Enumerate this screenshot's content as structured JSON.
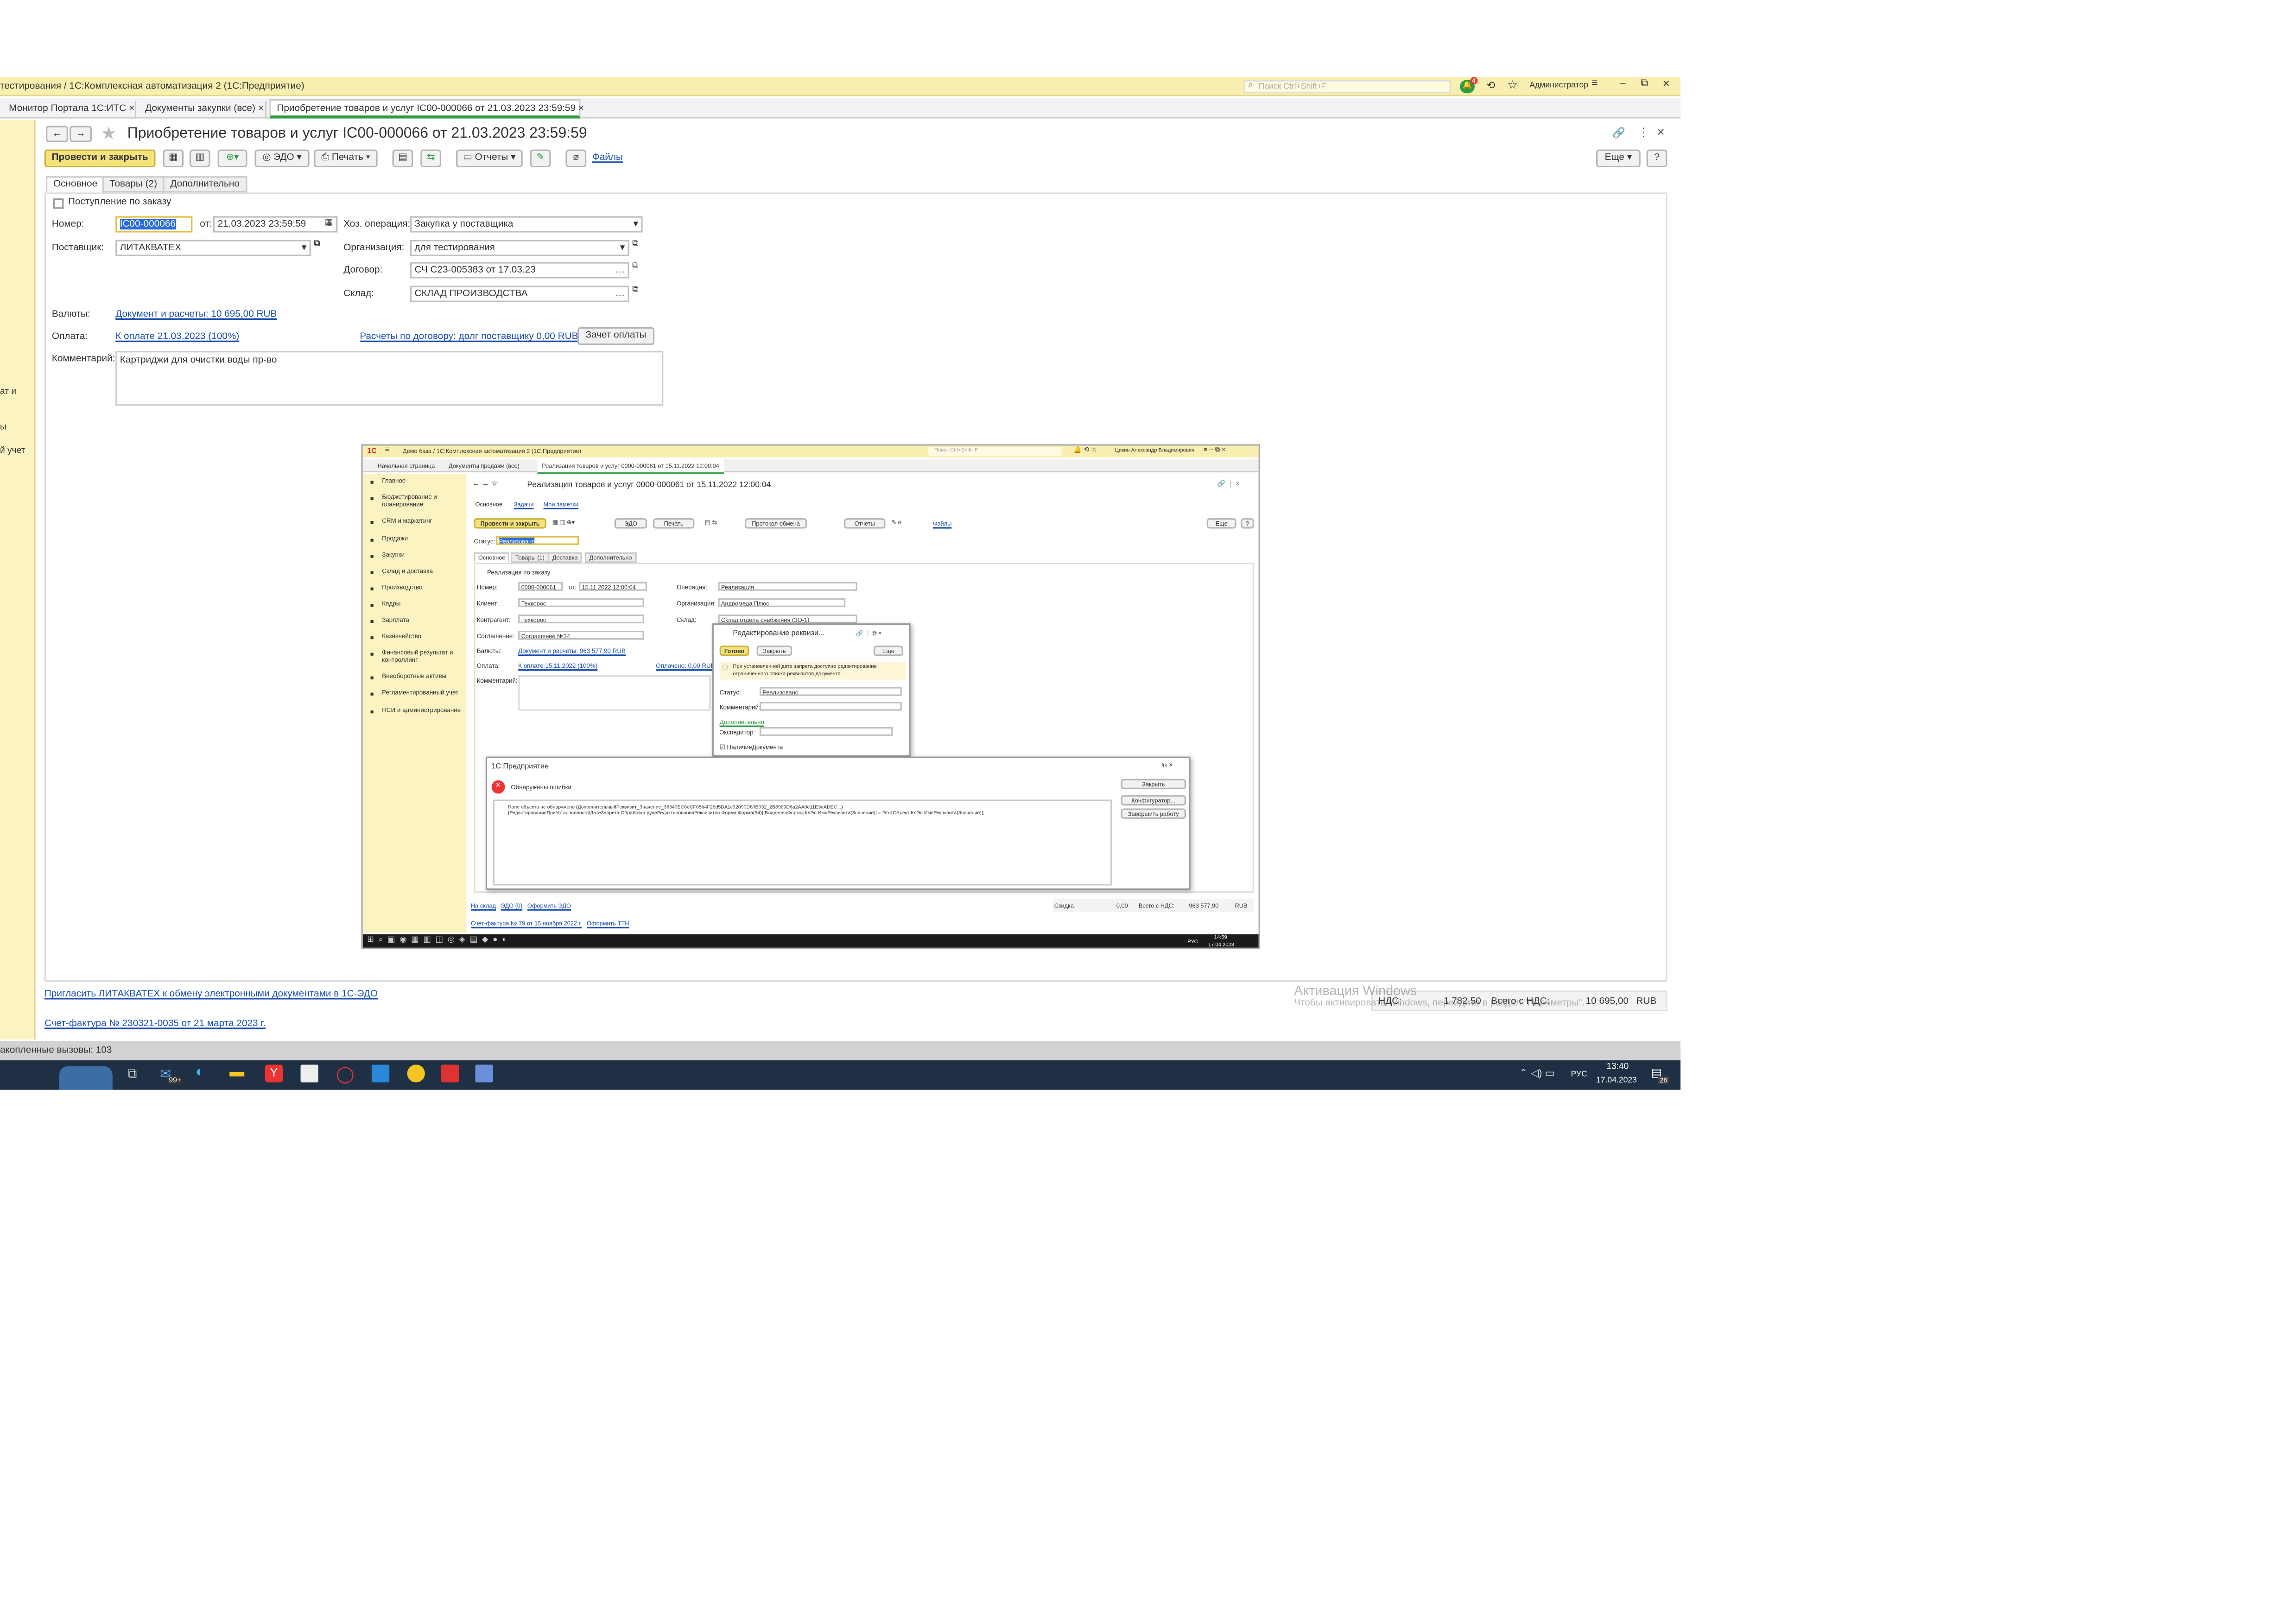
{
  "app": {
    "title": "тестирования / 1С:Комплексная автоматизация 2  (1С:Предприятие)",
    "search_placeholder": "Поиск Ctrl+Shift+F",
    "notif_count": "4",
    "user": "Администратор",
    "tabs": [
      "Монитор Портала 1С:ИТС",
      "Документы закупки (все)",
      "Приобретение товаров и услуг IC00-000066 от 21.03.2023 23:59:59"
    ]
  },
  "doc": {
    "title": "Приобретение товаров и услуг IC00-000066 от 21.03.2023 23:59:59",
    "toolbar": {
      "post_close": "Провести и закрыть",
      "edo": "ЭДО",
      "print": "Печать",
      "reports": "Отчеты",
      "files": "Файлы",
      "more": "Еще",
      "help": "?"
    },
    "tabs": [
      "Основное",
      "Товары (2)",
      "Дополнительно"
    ],
    "by_order": "Поступление по заказу",
    "number_label": "Номер:",
    "number": "IC00-000066",
    "from_label": "от:",
    "date": "21.03.2023 23:59:59",
    "operation_label": "Хоз. операция:",
    "operation": "Закупка у поставщика",
    "supplier_label": "Поставщик:",
    "supplier": "ЛИТАКВАТЕХ",
    "org_label": "Организация:",
    "org": "для тестирования",
    "contract_label": "Договор:",
    "contract": "СЧ С23-005383 от 17.03.23",
    "warehouse_label": "Склад:",
    "warehouse": "СКЛАД ПРОИЗВОДСТВА",
    "currency_label": "Валюты:",
    "currency_link": "Документ и расчеты: 10 695,00 RUB",
    "payment_label": "Оплата:",
    "payment_link": "К оплате 21.03.2023 (100%)",
    "debt_link": "Расчеты по договору: долг поставщику 0,00 RUB",
    "offset_btn": "Зачет оплаты",
    "comment_label": "Комментарий:",
    "comment": "Картриджи для очистки воды пр-во",
    "invite_link": "Пригласить ЛИТАКВАТЕХ к обмену электронными документами в 1С-ЭДО",
    "invoice_link": "Счет-фактура № 230321-0035 от 21 марта 2023 г.",
    "vat_label": "НДС:",
    "vat": "1 782,50",
    "total_label": "Всего с НДС:",
    "total": "10 695,00",
    "cur": "RUB"
  },
  "left_partial": [
    "ат и",
    "ы",
    "й учет"
  ],
  "watermark": {
    "line1": "Активация Windows",
    "line2": "Чтобы активировать Windows, перейдите в раздел \"Параметры\"."
  },
  "status_bar": "акопленные вызовы: 103",
  "taskbar": {
    "badge": "99+",
    "lang": "РУС",
    "time": "13:40",
    "date": "17.04.2023",
    "notif": "26"
  },
  "shot": {
    "title": "Демо база / 1С:Комплексная автоматизация 2  (1С:Предприятие)",
    "search_placeholder": "Поиск Ctrl+Shift+F",
    "user": "Цикин Александр Владимирович",
    "tabs": [
      "Начальная страница",
      "Документы продажи (все)",
      "Реализация товаров и услуг 0000-000061 от 15.11.2022 12:00:04"
    ],
    "sidebar": [
      "Главное",
      "Бюджетирование и планирование",
      "CRM и маркетинг",
      "Продажи",
      "Закупки",
      "Склад и доставка",
      "Производство",
      "Кадры",
      "Зарплата",
      "Казначейство",
      "Финансовый результат и контроллинг",
      "Внеоборотные активы",
      "Регламентированный учет",
      "НСИ и администрирование"
    ],
    "doc_title": "Реализация товаров и услуг 0000-000061 от 15.11.2022 12:00:04",
    "subtabs": [
      "Основное",
      "Задачи",
      "Мои заметки"
    ],
    "post_close": "Провести и закрыть",
    "edo": "ЭДО",
    "print": "Печать",
    "exchange": "Протокол обмена",
    "reports": "Отчеты",
    "files": "Файлы",
    "more": "Еще",
    "help": "?",
    "status_label": "Статус:",
    "status": "Реализовано",
    "inner_tabs": [
      "Основное",
      "Товары (1)",
      "Доставка",
      "Дополнительно"
    ],
    "by_order": "Реализация по заказу",
    "number_label": "Номер:",
    "number": "0000-000061",
    "from_label": "от:",
    "date": "15.11.2022 12:00:04",
    "operation_label": "Операция:",
    "operation": "Реализация",
    "client_label": "Клиент:",
    "client": "Техкорос",
    "org_label": "Организация:",
    "org": "Андромеда Плюс",
    "counterparty_label": "Контрагент:",
    "counterparty": "Техкорос",
    "warehouse_label": "Склад:",
    "warehouse": "Склад отдела снабжения (ЗО-1)",
    "agreement_label": "Соглашение:",
    "agreement": "Соглашение №34",
    "currency_label": "Валюты:",
    "currency_link": "Документ и расчеты: 963 577,90 RUB",
    "payment_label": "Оплата:",
    "payment_link": "К оплате 15.11.2022 (100%)",
    "payment_link2": "Оплачено: 0,00 RUB",
    "comment_label": "Комментарий:",
    "footer_links": [
      "На склад",
      "ЭДО (0)",
      "Оформить ЭДО"
    ],
    "footer_links2": [
      "Счет-фактура № 79 от 15 ноября 2022 г.",
      "Оформить ТТН"
    ],
    "discount_label": "Скидка",
    "discount": "0,00",
    "total_label": "Всего с НДС:",
    "total": "963 577,90",
    "cur": "RUB",
    "lang": "РУС",
    "time": "14:59",
    "date2": "17.04.2023",
    "edit": {
      "title": "Редактирование реквизи...",
      "ok": "Готово",
      "close": "Закрыть",
      "more": "Еще",
      "info": "При установленной дате запрета доступно редактирование ограниченного списка реквизитов документа",
      "status_label": "Статус:",
      "status": "Реализовано",
      "comment_label": "Комментарий:",
      "extra_link": "Дополнительно",
      "forwarder_label": "Экспедитор:",
      "check_label": "НаличиеДокумента"
    },
    "error": {
      "title": "1С:Предприятие",
      "heading": "Обнаружены ошибки",
      "line1": "Поле объекта не обнаружено (ДополнительныйРеквизит_Значение_36340EC6eCF05b4F28d5DA1c32090D60B032_2B8989D6a2AA0e11E3eADEC...)",
      "line2": "{РедактированиеПриУстановленнойДатеЗапрета.Обработка.рудеРедактированияРеквизитов.Форма.Форма(54)}:ВладелецФормы[КлЭл.ИмяРеквизита(Значение)] = ЭтотОбъект[КлЭл.ИмяРеквизита(Значение)];",
      "close": "Закрыть",
      "configurator": "Конфигуратор...",
      "finish": "Завершить работу"
    }
  }
}
